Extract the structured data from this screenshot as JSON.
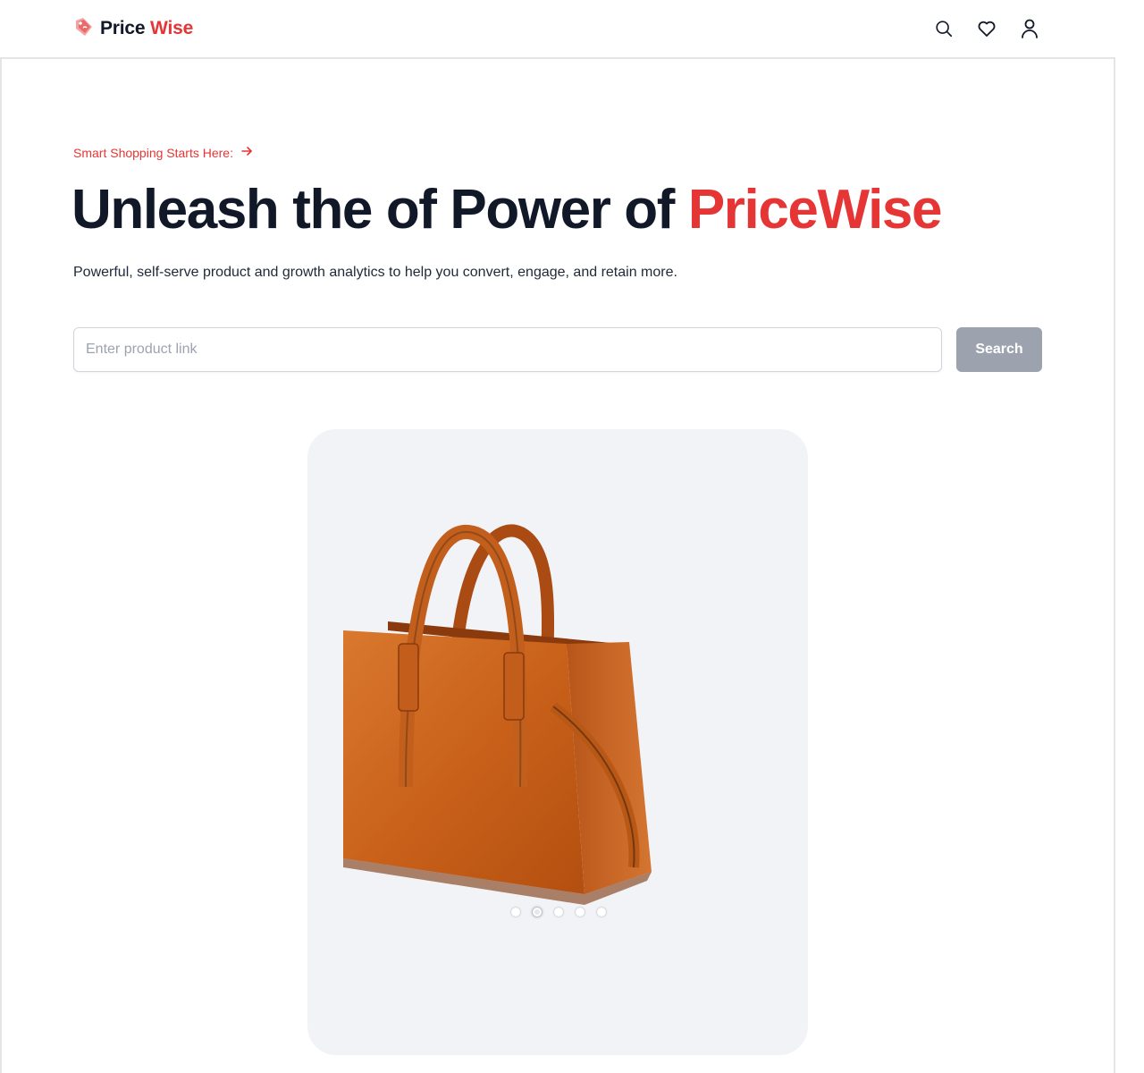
{
  "navbar": {
    "logo_text_1": "Price",
    "logo_text_2": "Wise",
    "icons": [
      "search-icon",
      "heart-icon",
      "user-icon"
    ]
  },
  "hero": {
    "eyebrow": "Smart Shopping Starts Here:",
    "headline_main": "Unleash the of Power of ",
    "headline_brand": "PriceWise",
    "subtext": "Powerful, self-serve product and growth analytics to help you convert, engage, and retain more."
  },
  "search": {
    "placeholder": "Enter product link",
    "value": "",
    "button_label": "Search"
  },
  "carousel": {
    "slide_count": 5,
    "active_index": 1
  },
  "colors": {
    "accent": "#e53535",
    "text_dark": "#111827",
    "button_disabled": "#9ca3af",
    "carousel_bg": "#f2f3f7"
  }
}
